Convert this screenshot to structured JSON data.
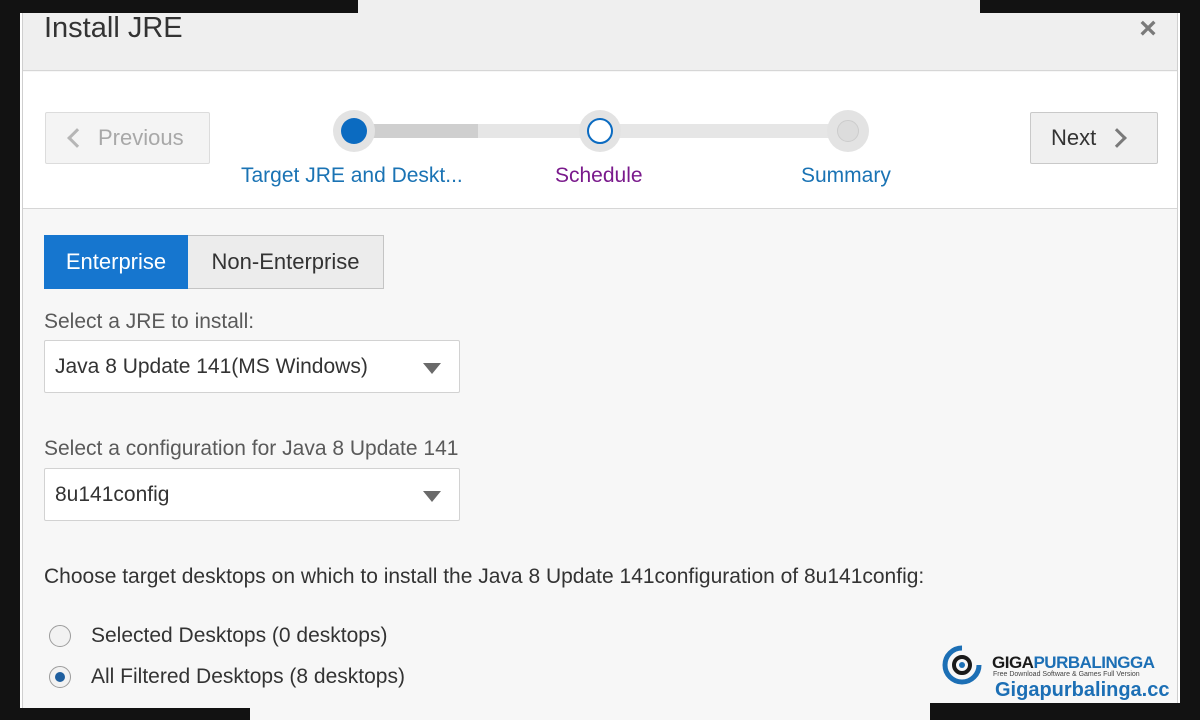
{
  "dialog": {
    "title": "Install JRE",
    "close_label": "×"
  },
  "wizard": {
    "previous_label": "Previous",
    "next_label": "Next",
    "steps": [
      {
        "label": "Target JRE and Deskt...",
        "state": "current"
      },
      {
        "label": "Schedule",
        "state": "next"
      },
      {
        "label": "Summary",
        "state": "pending"
      }
    ]
  },
  "tabs": {
    "enterprise": "Enterprise",
    "non_enterprise": "Non-Enterprise",
    "selected": "Enterprise"
  },
  "jre_select": {
    "label": "Select a JRE to install:",
    "value": "Java 8 Update 141(MS Windows)"
  },
  "config_select": {
    "label": "Select a configuration for Java 8 Update 141",
    "value": "8u141config"
  },
  "targets": {
    "prompt": "Choose target desktops on which to install the Java 8 Update 141configuration of 8u141config:",
    "options": [
      {
        "label": "Selected Desktops (0 desktops)",
        "checked": false
      },
      {
        "label": "All Filtered Desktops (8 desktops)",
        "checked": true
      }
    ]
  },
  "watermark": {
    "brand_left": "GIGA",
    "brand_right": "PURBALINGGA",
    "tagline": "Free Download Software & Games Full Version",
    "url": "Gigapurbalinga.cc"
  },
  "colors": {
    "accent": "#1676cf",
    "step_link": "#1a73b4",
    "step_visited": "#7a1a8c",
    "frame": "#121212"
  },
  "icons": {
    "previous": "chevron-left-icon",
    "next": "chevron-right-icon",
    "close": "close-icon",
    "dropdown": "caret-down-icon"
  }
}
